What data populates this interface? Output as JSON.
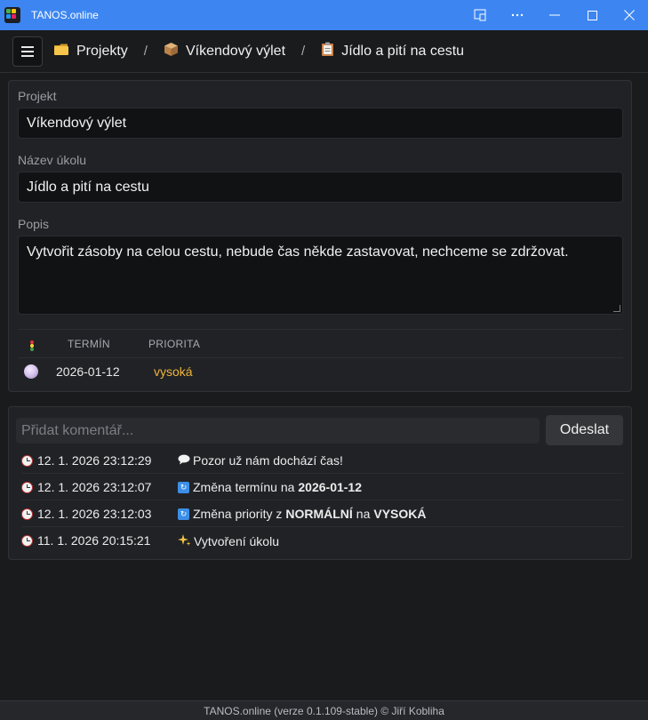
{
  "window": {
    "title": "TANOS.online",
    "controls": [
      "cast-icon",
      "more-icon",
      "minimize-icon",
      "maximize-icon",
      "close-icon"
    ],
    "titlebar_color": "#3d86f2"
  },
  "breadcrumb": [
    {
      "label": "Projekty",
      "icon": "folder-icon"
    },
    {
      "label": "Víkendový výlet",
      "icon": "package-icon"
    },
    {
      "label": "Jídlo a pití na cestu",
      "icon": "clipboard-icon"
    }
  ],
  "breadcrumb_separator": "/",
  "task": {
    "project_label": "Projekt",
    "project_value": "Víkendový výlet",
    "name_label": "Název úkolu",
    "name_value": "Jídlo a pití na cestu",
    "description_label": "Popis",
    "description_value": "Vytvořit zásoby na celou cestu, nebude čas někde zastavovat, nechceme se zdržovat.",
    "columns": {
      "deadline": "TERMÍN",
      "priority": "PRIORITA"
    },
    "deadline": "2026-01-12",
    "priority": "vysoká",
    "priority_color": "#f0b43c"
  },
  "comments": {
    "placeholder": "Přidat komentář...",
    "send_label": "Odeslat",
    "log": [
      {
        "time": "12. 1. 2026 23:12:29",
        "icon": "speech-bubble-icon",
        "parts": [
          {
            "t": "Pozor už nám dochází čas!",
            "b": false
          }
        ]
      },
      {
        "time": "12. 1. 2026 23:12:07",
        "icon": "refresh-icon",
        "parts": [
          {
            "t": "Změna termínu na",
            "b": false
          },
          {
            "t": "2026-01-12",
            "b": true
          }
        ]
      },
      {
        "time": "12. 1. 2026 23:12:03",
        "icon": "refresh-icon",
        "parts": [
          {
            "t": "Změna priority z",
            "b": false
          },
          {
            "t": "NORMÁLNÍ",
            "b": true
          },
          {
            "t": "na",
            "b": false
          },
          {
            "t": "VYSOKÁ",
            "b": true
          }
        ]
      },
      {
        "time": "11. 1. 2026 20:15:21",
        "icon": "sparkles-icon",
        "parts": [
          {
            "t": "Vytvoření úkolu",
            "b": false
          }
        ]
      }
    ]
  },
  "footer": "TANOS.online (verze 0.1.109-stable) © Jiří Kobliha"
}
